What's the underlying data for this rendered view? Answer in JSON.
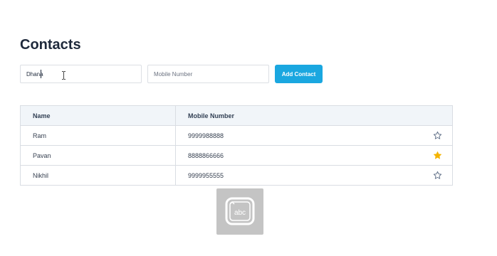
{
  "page": {
    "title": "Contacts"
  },
  "form": {
    "name_value": "Dhana",
    "mobile_placeholder": "Mobile Number",
    "mobile_value": "",
    "add_label": "Add Contact"
  },
  "table": {
    "headers": [
      "Name",
      "Mobile Number"
    ],
    "rows": [
      {
        "name": "Ram",
        "mobile": "9999988888",
        "starred": false
      },
      {
        "name": "Pavan",
        "mobile": "8888866666",
        "starred": true
      },
      {
        "name": "Nikhil",
        "mobile": "9999955555",
        "starred": false
      }
    ]
  },
  "overlay": {
    "label": "abc"
  },
  "colors": {
    "accent": "#1aa7e0",
    "star_active": "#f4b400",
    "star_inactive": "#64748b",
    "header_bg": "#f1f5f9"
  },
  "icons": {
    "star_filled": "star-filled-icon",
    "star_outline": "star-outline-icon",
    "keyboard": "keyboard-abc-icon"
  }
}
